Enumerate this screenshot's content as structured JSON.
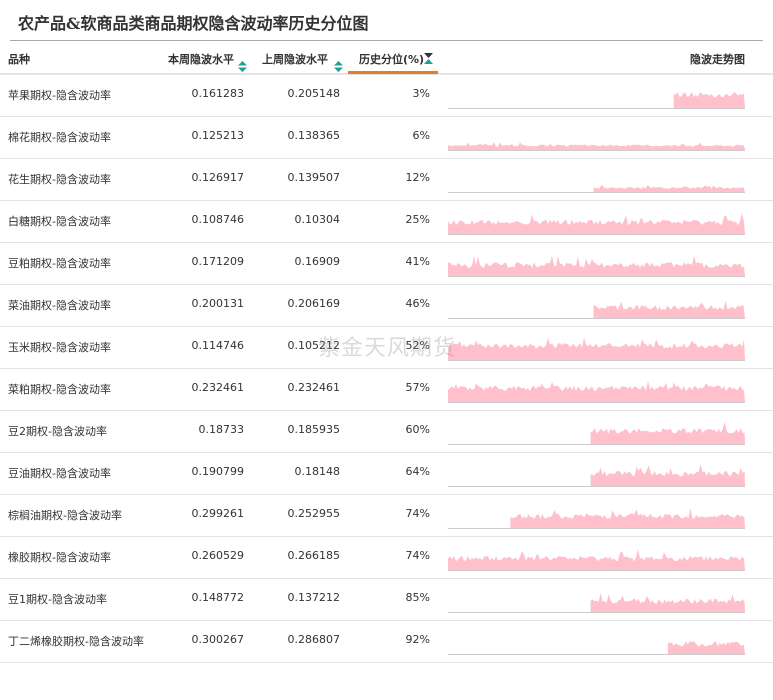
{
  "title": "农产品&软商品类商品期权隐含波动率历史分位图",
  "watermark": "紫金天风期货",
  "colors": {
    "accent": "#e67e22",
    "sort": "#1aa394",
    "spark": "#ffc0cb"
  },
  "headers": {
    "name": "品种",
    "current": "本周隐波水平",
    "previous": "上周隐波水平",
    "percentile": "历史分位(%)",
    "trend": "隐波走势图"
  },
  "rows": [
    {
      "name": "苹果期权-隐含波动率",
      "current": "0.161283",
      "previous": "0.205148",
      "percentile": "3%"
    },
    {
      "name": "棉花期权-隐含波动率",
      "current": "0.125213",
      "previous": "0.138365",
      "percentile": "6%"
    },
    {
      "name": "花生期权-隐含波动率",
      "current": "0.126917",
      "previous": "0.139507",
      "percentile": "12%"
    },
    {
      "name": "白糖期权-隐含波动率",
      "current": "0.108746",
      "previous": "0.10304",
      "percentile": "25%"
    },
    {
      "name": "豆粕期权-隐含波动率",
      "current": "0.171209",
      "previous": "0.16909",
      "percentile": "41%"
    },
    {
      "name": "菜油期权-隐含波动率",
      "current": "0.200131",
      "previous": "0.206169",
      "percentile": "46%"
    },
    {
      "name": "玉米期权-隐含波动率",
      "current": "0.114746",
      "previous": "0.105212",
      "percentile": "52%"
    },
    {
      "name": "菜粕期权-隐含波动率",
      "current": "0.232461",
      "previous": "0.232461",
      "percentile": "57%"
    },
    {
      "name": "豆2期权-隐含波动率",
      "current": "0.18733",
      "previous": "0.185935",
      "percentile": "60%"
    },
    {
      "name": "豆油期权-隐含波动率",
      "current": "0.190799",
      "previous": "0.18148",
      "percentile": "64%"
    },
    {
      "name": "棕榈油期权-隐含波动率",
      "current": "0.299261",
      "previous": "0.252955",
      "percentile": "74%"
    },
    {
      "name": "橡胶期权-隐含波动率",
      "current": "0.260529",
      "previous": "0.266185",
      "percentile": "74%"
    },
    {
      "name": "豆1期权-隐含波动率",
      "current": "0.148772",
      "previous": "0.137212",
      "percentile": "85%"
    },
    {
      "name": "丁二烯橡胶期权-隐含波动率",
      "current": "0.300267",
      "previous": "0.286807",
      "percentile": "92%"
    }
  ]
}
